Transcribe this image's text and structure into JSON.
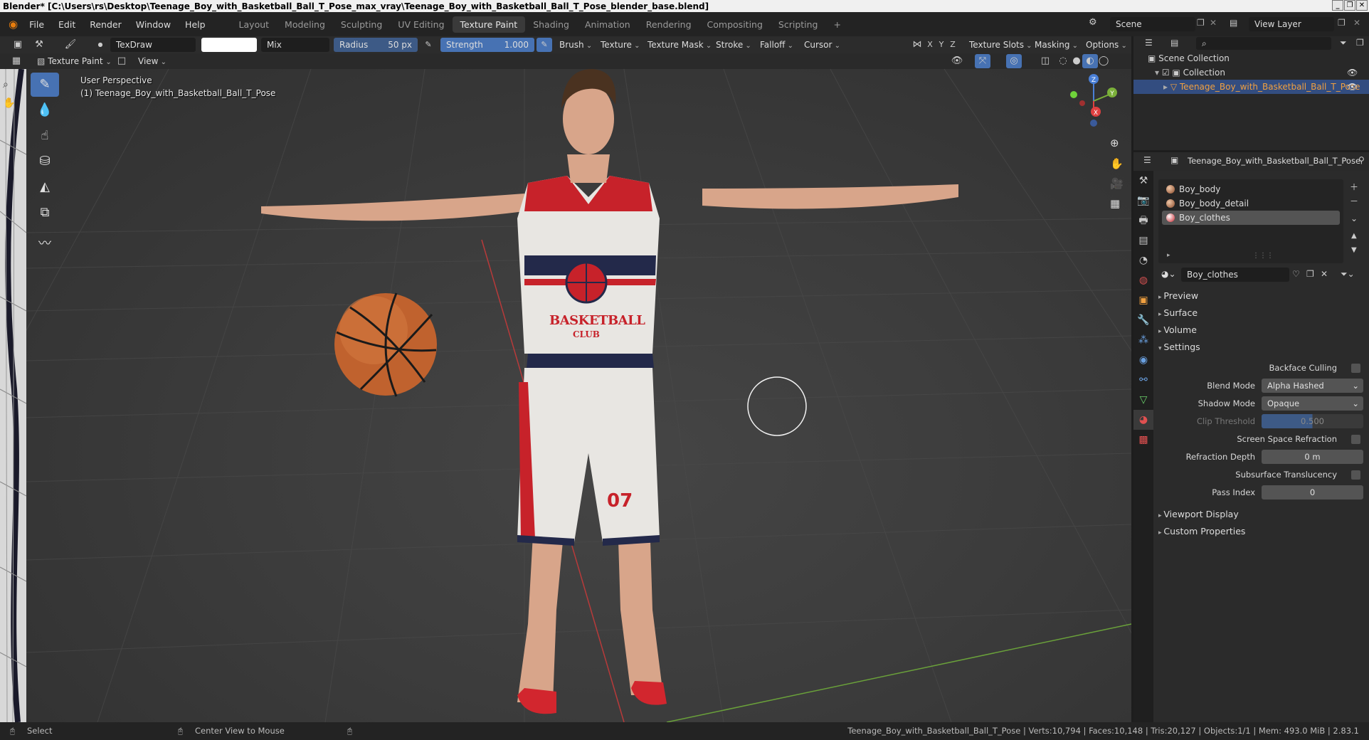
{
  "window": {
    "title": "Blender* [C:\\Users\\rs\\Desktop\\Teenage_Boy_with_Basketball_Ball_T_Pose_max_vray\\Teenage_Boy_with_Basketball_Ball_T_Pose_blender_base.blend]",
    "controls": [
      "_",
      "❐",
      "✕"
    ]
  },
  "menu": [
    "File",
    "Edit",
    "Render",
    "Window",
    "Help"
  ],
  "workspaces": [
    "Layout",
    "Modeling",
    "Sculpting",
    "UV Editing",
    "Texture Paint",
    "Shading",
    "Animation",
    "Rendering",
    "Compositing",
    "Scripting",
    "+"
  ],
  "active_workspace": "Texture Paint",
  "scene": {
    "scene_name": "Scene",
    "view_layer": "View Layer"
  },
  "tool_header": {
    "brush_name": "TexDraw",
    "blend": "Mix",
    "radius_label": "Radius",
    "radius_value": "50 px",
    "strength_label": "Strength",
    "strength_value": "1.000",
    "menus": [
      "Brush",
      "Texture",
      "Texture Mask",
      "Stroke",
      "Falloff",
      "Cursor"
    ],
    "axes": [
      "X",
      "Y",
      "Z"
    ],
    "right_menus": [
      "Texture Slots",
      "Masking",
      "Options"
    ],
    "colors": {
      "brush_color": "#ffffff"
    }
  },
  "viewport_header": {
    "mode": "Texture Paint",
    "view_menu": "View"
  },
  "viewport": {
    "perspective": "User Perspective",
    "object_label": "(1) Teenage_Boy_with_Basketball_Ball_T_Pose",
    "jersey_text_1": "BASKETBALL",
    "jersey_text_2": "CLUB",
    "shorts_number": "07",
    "gizmo_axes": [
      "X",
      "Y",
      "Z"
    ]
  },
  "outliner": {
    "root": "Scene Collection",
    "collection": "Collection",
    "object": "Teenage_Boy_with_Basketball_Ball_T_Pose"
  },
  "properties": {
    "object_name": "Teenage_Boy_with_Basketball_Ball_T_Pose",
    "material_slots": [
      "Boy_body",
      "Boy_body_detail",
      "Boy_clothes"
    ],
    "selected_slot": "Boy_clothes",
    "material_name": "Boy_clothes",
    "panels": [
      "Preview",
      "Surface",
      "Volume",
      "Settings"
    ],
    "settings": {
      "backface_culling": "Backface Culling",
      "blend_mode_label": "Blend Mode",
      "blend_mode_value": "Alpha Hashed",
      "shadow_mode_label": "Shadow Mode",
      "shadow_mode_value": "Opaque",
      "clip_threshold_label": "Clip Threshold",
      "clip_threshold_value": "0.500",
      "screen_space_refraction": "Screen Space Refraction",
      "refraction_depth_label": "Refraction Depth",
      "refraction_depth_value": "0 m",
      "subsurface_translucency": "Subsurface Translucency",
      "pass_index_label": "Pass Index",
      "pass_index_value": "0"
    },
    "bottom_panels": [
      "Viewport Display",
      "Custom Properties"
    ]
  },
  "statusbar": {
    "select": "Select",
    "center_view": "Center View to Mouse",
    "stats": "Teenage_Boy_with_Basketball_Ball_T_Pose | Verts:10,794 | Faces:10,148 | Tris:20,127 | Objects:1/1 | Mem: 493.0 MiB | 2.83.1"
  },
  "accent_colors": {
    "active_blue": "#4772b3",
    "selected_row": "#334d80",
    "highlight_orange": "#f0a040"
  }
}
